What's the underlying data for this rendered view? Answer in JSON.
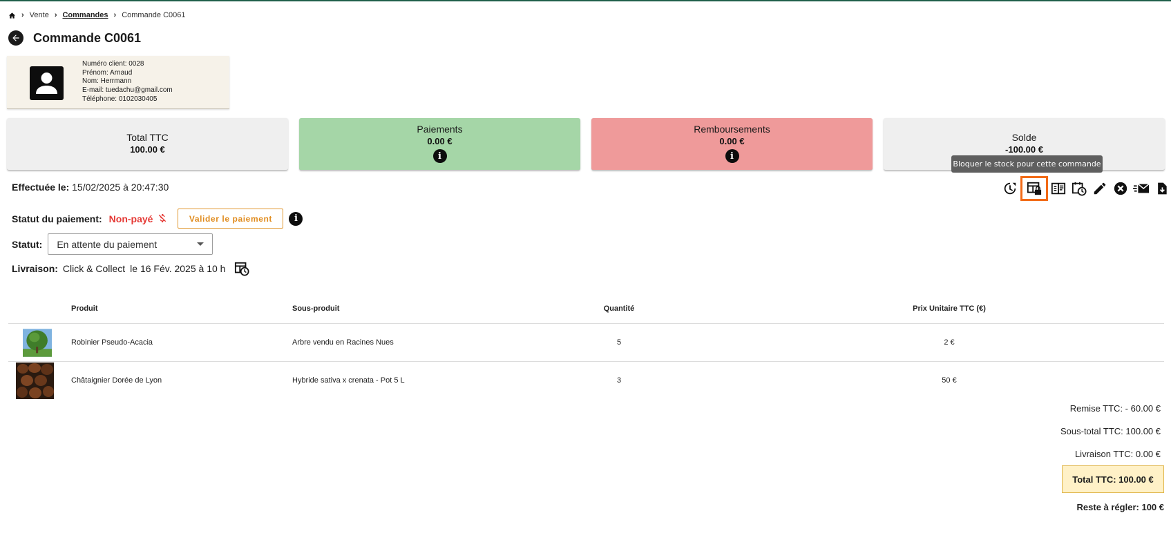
{
  "breadcrumb": {
    "home_icon": "home-icon",
    "items": [
      "Vente",
      "Commandes",
      "Commande C0061"
    ]
  },
  "page": {
    "title": "Commande C0061",
    "back_icon": "arrow-left-icon"
  },
  "client": {
    "avatar_icon": "user-avatar-icon",
    "number": "Numéro client: 0028",
    "first_name": "Prénom: Arnaud",
    "last_name": "Nom: Herrmann",
    "email": "E-mail: tuedachu@gmail.com",
    "phone": "Téléphone: 0102030405"
  },
  "cards": {
    "total": {
      "label": "Total TTC",
      "value": "100.00 €",
      "color": "#efefef"
    },
    "payments": {
      "label": "Paiements",
      "value": "0.00 €",
      "color": "#a5d6a7",
      "info_icon": "info-icon"
    },
    "refunds": {
      "label": "Remboursements",
      "value": "0.00 €",
      "color": "#ef9a9a",
      "info_icon": "info-icon"
    },
    "balance": {
      "label": "Solde",
      "value": "-100.00 €",
      "color": "#efefef"
    }
  },
  "tooltip": "Bloquer le stock pour cette commande",
  "order": {
    "done_label": "Effectuée le:",
    "done_value": "15/02/2025 à 20:47:30"
  },
  "actions": [
    {
      "name": "history-icon"
    },
    {
      "name": "lock-stock-icon"
    },
    {
      "name": "invoice-icon"
    },
    {
      "name": "schedule-icon"
    },
    {
      "name": "edit-icon"
    },
    {
      "name": "cancel-icon"
    },
    {
      "name": "email-icon"
    },
    {
      "name": "download-icon"
    }
  ],
  "payment": {
    "label": "Statut du paiement:",
    "status": "Non-payé",
    "status_color": "#e53935",
    "button": "Valider le paiement"
  },
  "status": {
    "label": "Statut:",
    "selected": "En attente du paiement"
  },
  "delivery": {
    "label": "Livraison:",
    "method": "Click & Collect",
    "date": "le 16 Fév. 2025 à 10 h"
  },
  "table": {
    "headers": [
      "Produit",
      "Sous-produit",
      "Quantité",
      "Prix Unitaire TTC (€)"
    ],
    "rows": [
      {
        "product": "Robinier Pseudo-Acacia",
        "sub": "Arbre vendu en Racines Nues",
        "qty": "5",
        "price": "2 €"
      },
      {
        "product": "Châtaignier Dorée de Lyon",
        "sub": "Hybride sativa x crenata - Pot 5 L",
        "qty": "3",
        "price": "50 €"
      }
    ]
  },
  "totals": {
    "discount": "Remise TTC: - 60.00 €",
    "subtotal": "Sous-total TTC: 100.00 €",
    "delivery": "Livraison TTC: 0.00 €",
    "total": "Total TTC: 100.00 €",
    "rest": "Reste à régler: 100 €"
  }
}
